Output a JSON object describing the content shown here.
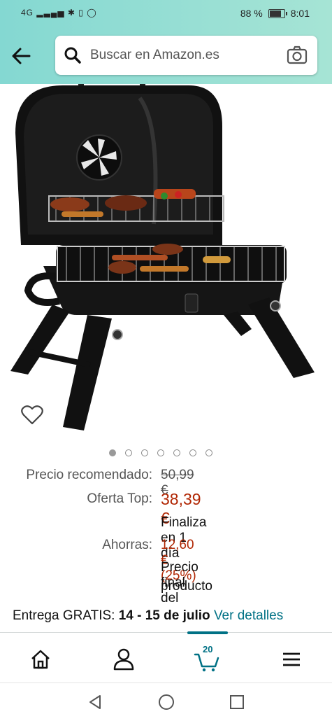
{
  "status_bar": {
    "network": "4G",
    "battery_percent": "88 %",
    "battery_level": 0.88,
    "time": "8:01"
  },
  "search": {
    "placeholder": "Buscar en Amazon.es"
  },
  "carousel": {
    "total": 7,
    "active_index": 0
  },
  "pricing": {
    "list_price_label": "Precio recomendado:",
    "list_price": "50,99 €",
    "deal_label": "Oferta Top:",
    "deal_price": "38,39 €",
    "deal_ends": "Finaliza en 1 día",
    "savings_label": "Ahorras:",
    "savings": "12,60 € (25%)",
    "final_price_note_line1": "Precio final del",
    "final_price_note_line2": "producto"
  },
  "delivery": {
    "prefix": "Entrega GRATIS:",
    "dates": "14 - 15 de julio",
    "link": "Ver detalles"
  },
  "bottom_nav": {
    "cart_count": "20"
  },
  "colors": {
    "header_gradient_start": "#84d8d2",
    "header_gradient_end": "#a6e4d5",
    "price_red": "#b12704",
    "link_teal": "#007185"
  }
}
